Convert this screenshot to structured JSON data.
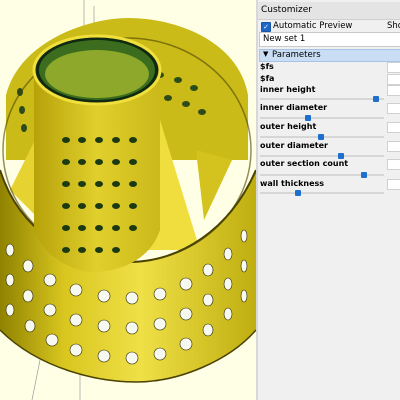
{
  "customizer": {
    "title": "Customizer",
    "automatic_preview_label": "Automatic Preview",
    "automatic_preview_checked": true,
    "show_label": "Sho",
    "preset_name": "New set 1",
    "parameters_header": "Parameters",
    "params": [
      {
        "label": "$fs"
      },
      {
        "label": "$fa"
      },
      {
        "label": "inner height",
        "slider_fraction": 0.96
      },
      {
        "label": "inner diameter",
        "slider_fraction": 0.38
      },
      {
        "label": "outer height",
        "slider_fraction": 0.49
      },
      {
        "label": "outer diameter",
        "slider_fraction": 0.66
      },
      {
        "label": "outer section count",
        "slider_fraction": 0.86
      },
      {
        "label": "wall thickness",
        "slider_fraction": 0.3
      }
    ]
  },
  "colors": {
    "accent": "#1f6fcf",
    "model_fill": "#f2e23a",
    "model_dark": "#7a6a00",
    "viewport_bg": "#ffffe5"
  }
}
